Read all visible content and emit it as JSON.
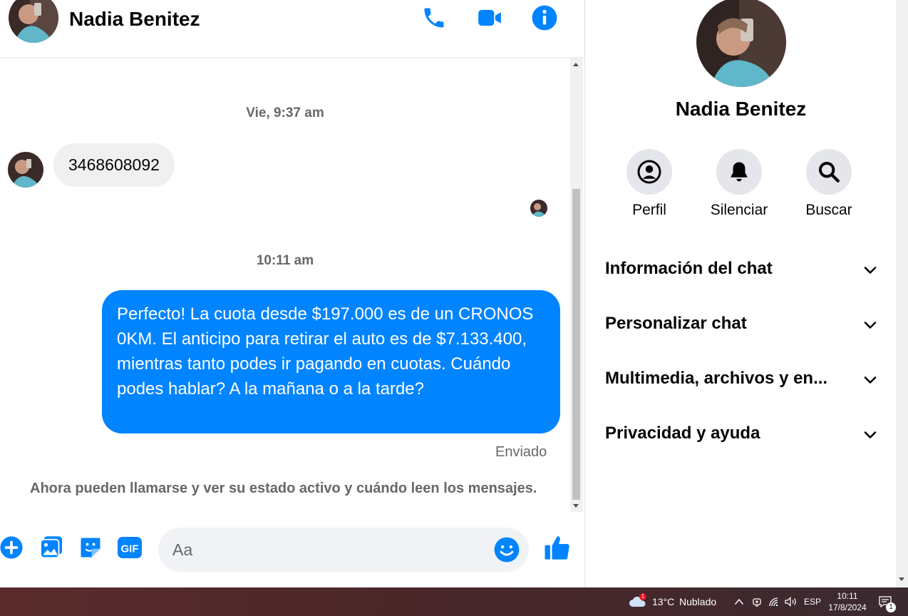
{
  "conversation": {
    "contact_name": "Nadia Benitez",
    "colors": {
      "accent": "#0084ff",
      "bubble_in": "#f0f0f0",
      "muted_text": "#65676b"
    }
  },
  "header": {
    "icons": [
      "phone-icon",
      "video-camera-icon",
      "info-icon"
    ]
  },
  "messages": {
    "timestamp_1": "Vie, 9:37 am",
    "incoming_text": "3468608092",
    "timestamp_2": "10:11 am",
    "outgoing_text": "Perfecto! La cuota desde $197.000 es de un CRONOS 0KM. El anticipo para retirar el auto es de $7.133.400, mientras tanto podes ir pagando en cuotas. Cuándo podes hablar? A la mañana o a la tarde?",
    "status": "Enviado",
    "notice": "Ahora pueden llamarse y ver su estado activo y cuándo leen los mensajes."
  },
  "composer": {
    "placeholder": "Aa",
    "icons": [
      "plus-icon",
      "image-icon",
      "sticker-icon",
      "gif-icon",
      "emoji-icon",
      "thumbs-up-icon"
    ],
    "gif_label": "GIF"
  },
  "details": {
    "name": "Nadia Benitez",
    "actions": [
      {
        "label": "Perfil",
        "icon": "profile-icon"
      },
      {
        "label": "Silenciar",
        "icon": "bell-icon"
      },
      {
        "label": "Buscar",
        "icon": "search-icon"
      }
    ],
    "sections": [
      "Información del chat",
      "Personalizar chat",
      "Multimedia, archivos y en...",
      "Privacidad y ayuda"
    ]
  },
  "taskbar": {
    "weather_temp": "13°C",
    "weather_desc": "Nublado",
    "weather_badge": "1",
    "language": "ESP",
    "time": "10:11",
    "date": "17/8/2024",
    "notification_count": "1"
  }
}
